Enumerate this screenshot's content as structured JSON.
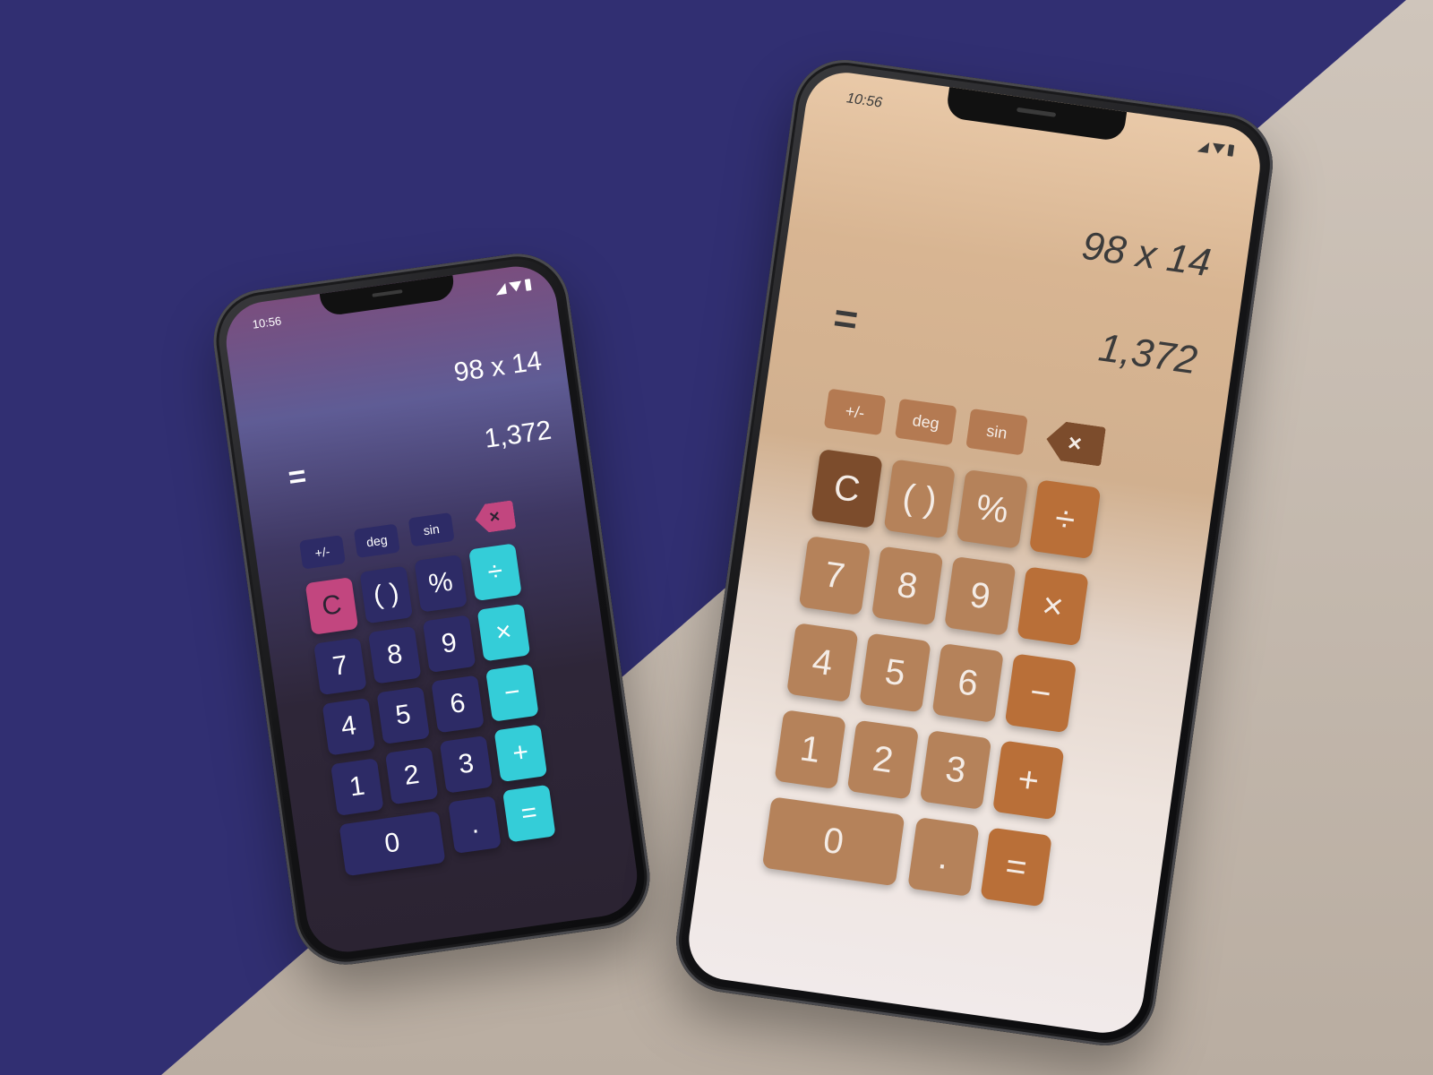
{
  "status": {
    "time": "10:56"
  },
  "display": {
    "expression": "98 x 14",
    "equals": "=",
    "result": "1,372"
  },
  "function_keys": {
    "sign": "+/-",
    "deg": "deg",
    "sin": "sin",
    "backspace": "×"
  },
  "keys": {
    "clear": "C",
    "parens": "( )",
    "percent": "%",
    "divide": "÷",
    "seven": "7",
    "eight": "8",
    "nine": "9",
    "multiply": "×",
    "four": "4",
    "five": "5",
    "six": "6",
    "minus": "−",
    "one": "1",
    "two": "2",
    "three": "3",
    "plus": "+",
    "zero": "0",
    "dot": ".",
    "equals": "="
  },
  "colors": {
    "background_navy": "#312f72",
    "background_floor": "#c9beb3",
    "dark_theme_key": "#2d2b66",
    "dark_theme_accent": "#34cdd8",
    "dark_theme_clear": "#c2467f",
    "light_theme_key": "#b5825a",
    "light_theme_operator": "#b96f38",
    "light_theme_clear": "#7c4c2c"
  }
}
